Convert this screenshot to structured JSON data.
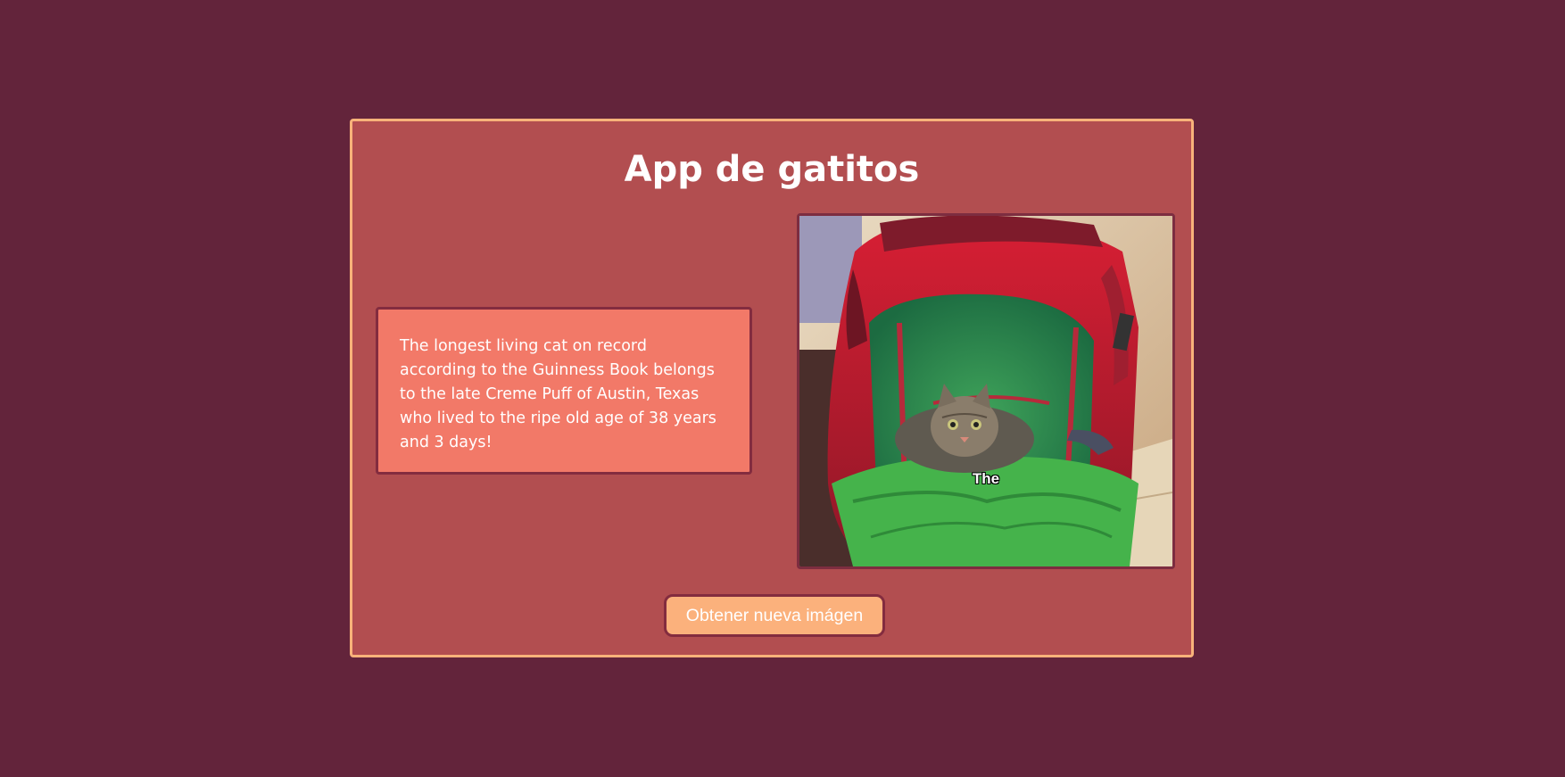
{
  "app": {
    "title": "App de gatitos"
  },
  "fact": {
    "text": "The longest living cat on record according to the Guinness Book belongs to the late Creme Puff of Austin, Texas who lived to the ripe old age of 38 years and 3 days!"
  },
  "cat_image": {
    "caption": "The",
    "subject": "cat sitting inside an open red and green backpack"
  },
  "actions": {
    "new_image_label": "Obtener nueva imágen"
  },
  "colors": {
    "page_background": "#63243b",
    "card_background": "#b24e50",
    "card_border": "#f8b37a",
    "fact_background": "#f27968",
    "button_background": "#fbb17c",
    "dark_border": "#832c3f",
    "text": "#ffffff"
  }
}
